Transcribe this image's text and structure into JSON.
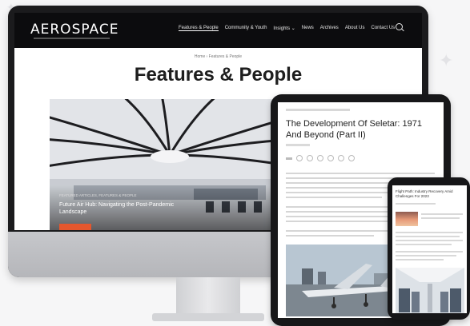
{
  "website": {
    "logo": "AEROSPACE",
    "nav": [
      "Features & People",
      "Community & Youth",
      "Insights ⌄",
      "News",
      "Archives",
      "About Us",
      "Contact Us"
    ],
    "breadcrumb": "Home  ›  Features & People",
    "page_title": "Features & People",
    "hero": {
      "kicker": "FEATURED ARTICLES, FEATURES & PEOPLE",
      "headline": "Future Air Hub: Navigating the Post-Pandemic Landscape"
    }
  },
  "tablet": {
    "article_title": "The Development Of Seletar: 1971 And Beyond (Part II)"
  },
  "phone": {
    "article_title": "Flight Path: Industry Recovery Amid Challenges For 2023"
  },
  "colors": {
    "header_bg": "#0c0c0e",
    "accent": "#e4572e",
    "device_frame": "#1b1b1d"
  }
}
